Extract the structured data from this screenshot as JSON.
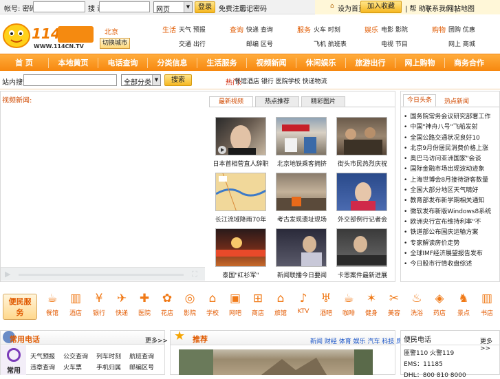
{
  "topbar": {
    "account_label": "帐号: 密码:",
    "account_value": "",
    "pass_label": "搜 索:",
    "pass_value": "",
    "select": "网页",
    "login_button": "登录",
    "register_link": "免费注册 |",
    "help_link": "忘记密码",
    "right_links": [
      "设为首页",
      "加入收藏",
      "| 帮 助 |",
      "联系我们 |",
      "网站地图"
    ]
  },
  "header": {
    "city_name": "北京",
    "switch_city": "切换城市",
    "groups": [
      {
        "label": "生活",
        "items": [
          "天气 预报",
          "交通 出行"
        ]
      },
      {
        "label": "查询",
        "items": [
          "快递 查询",
          "邮编 区号"
        ]
      },
      {
        "label": "服务",
        "items": [
          "火车 时刻",
          "飞机 航班表"
        ]
      },
      {
        "label": "娱乐",
        "items": [
          "电影 影院",
          "电视 节目"
        ]
      },
      {
        "label": "购物",
        "items": [
          "团购 优惠",
          "网上 商城"
        ]
      }
    ]
  },
  "nav": [
    "首 页",
    "本地黄页",
    "电话查询",
    "分类信息",
    "生活服务",
    "视频新闻",
    "休闲娱乐",
    "旅游出行",
    "网上购物",
    "商务合作"
  ],
  "search": {
    "label": "站内搜索:",
    "value": "",
    "select": "全部分类",
    "button": "搜索",
    "hot_label": "热门:",
    "hot_items": "餐馆酒店 银行 医院学校 快递物流"
  },
  "video": {
    "title": "视频新闻:",
    "tabs": [
      "最新视频",
      "热点推荐",
      "精彩图片"
    ],
    "captions": [
      "日本首相菅直人辞职",
      "北京地铁乘客拥挤",
      "街头市民热烈庆祝",
      "长江流域降雨70年",
      "考古发现遗址现场",
      "外交部例行记者会",
      "泰国\"红衫军\"",
      "新闻联播今日要闻",
      "卡恩案件最新进展"
    ]
  },
  "news": {
    "tabs": [
      "今日头条",
      "热点新闻"
    ],
    "items": [
      "国务院常务会议研究部署工作",
      "中国\"神舟八号\"飞船发射",
      "全国公路交通状况良好10",
      "北京9月份居民消费价格上涨",
      "奥巴马访问亚洲国家\"会谈",
      "国际金融市场出现波动迹象",
      "上海世博会8月接待游客数量",
      "全国大部分地区天气晴好",
      "教育部发布新学期相关通知",
      "微软发布新版Windows8系统",
      "欧洲央行宣布维持利率\"不",
      "铁道部公布国庆运输方案",
      "专家解读房价走势",
      "全球IMF经济展望报告发布",
      "今日股市行情收盘综述"
    ]
  },
  "services": {
    "title": "便民服务",
    "items": [
      {
        "icon": "cup-icon",
        "label": "餐馆"
      },
      {
        "icon": "building-icon",
        "label": "酒店"
      },
      {
        "icon": "yen-icon",
        "label": "银行"
      },
      {
        "icon": "plane-icon",
        "label": "快递"
      },
      {
        "icon": "medical-icon",
        "label": "医院"
      },
      {
        "icon": "flower-icon",
        "label": "花店"
      },
      {
        "icon": "film-icon",
        "label": "影院"
      },
      {
        "icon": "school-icon",
        "label": "学校"
      },
      {
        "icon": "monitor-icon",
        "label": "网吧"
      },
      {
        "icon": "cart-icon",
        "label": "商店"
      },
      {
        "icon": "house-icon",
        "label": "旅馆"
      },
      {
        "icon": "mic-icon",
        "label": "KTV"
      },
      {
        "icon": "wine-icon",
        "label": "酒吧"
      },
      {
        "icon": "coffee-icon",
        "label": "咖啡"
      },
      {
        "icon": "fitness-icon",
        "label": "健身"
      },
      {
        "icon": "scissors-icon",
        "label": "美容"
      },
      {
        "icon": "bath-icon",
        "label": "洗浴"
      },
      {
        "icon": "pill-icon",
        "label": "药店"
      },
      {
        "icon": "deer-icon",
        "label": "景点"
      },
      {
        "icon": "books-icon",
        "label": "书店"
      }
    ]
  },
  "common": {
    "title": "常用电话",
    "more": "更多>>",
    "clock_label": "常用",
    "links": [
      "天气预报",
      "公交查询",
      "列车时刻",
      "航班查询",
      "违章查询",
      "火车票",
      "手机归属",
      "邮编区号"
    ]
  },
  "featured": {
    "title": "推荐",
    "links": "新闻 财经 体育 娱乐 汽车 科技 房产 游戏"
  },
  "phones": {
    "title": "便民电话",
    "more": "更多>>",
    "lines": [
      "匪警110 火警119",
      "EMS：11185",
      "DHL：800 810 8000"
    ]
  },
  "colors": {
    "accent": "#f7880f",
    "link_orange": "#e05a00",
    "blue_link": "#1a55c8"
  }
}
